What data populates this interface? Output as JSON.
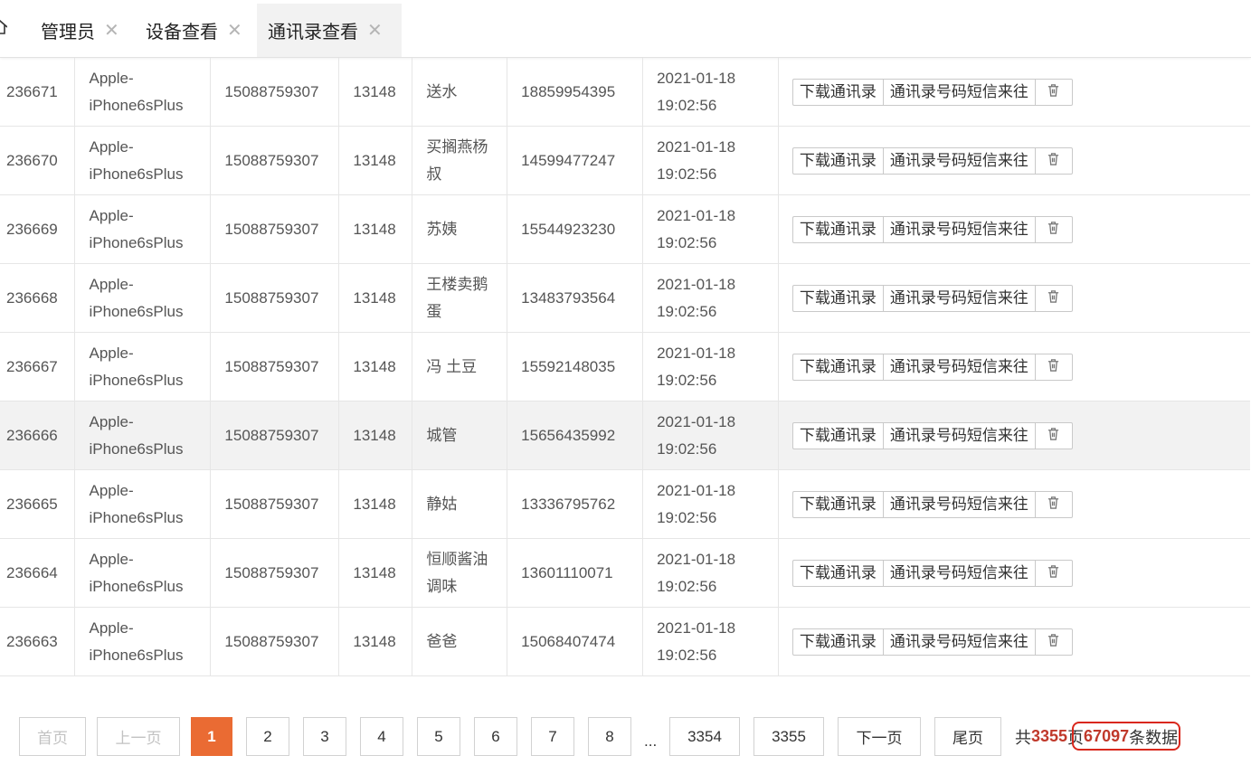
{
  "tabs": [
    {
      "label": "管理员"
    },
    {
      "label": "设备查看"
    },
    {
      "label": "通讯录查看"
    }
  ],
  "icons": {
    "home": "home-icon",
    "close": "close-icon",
    "delete": "trash-icon"
  },
  "colors": {
    "accent": "#ea6b33",
    "highlight": "#d9271c",
    "count": "#c0392b"
  },
  "table": {
    "rows": [
      {
        "id": "236671",
        "device": "Apple-iPhone6sPlus",
        "phone": "15088759307",
        "uid": "13148",
        "name": "送水",
        "number": "18859954395",
        "date": "2021-01-18",
        "time": "19:02:56"
      },
      {
        "id": "236670",
        "device": "Apple-iPhone6sPlus",
        "phone": "15088759307",
        "uid": "13148",
        "name": "买搁燕杨叔",
        "number": "14599477247",
        "date": "2021-01-18",
        "time": "19:02:56"
      },
      {
        "id": "236669",
        "device": "Apple-iPhone6sPlus",
        "phone": "15088759307",
        "uid": "13148",
        "name": "苏姨",
        "number": "15544923230",
        "date": "2021-01-18",
        "time": "19:02:56"
      },
      {
        "id": "236668",
        "device": "Apple-iPhone6sPlus",
        "phone": "15088759307",
        "uid": "13148",
        "name": "王楼卖鹅蛋",
        "number": "13483793564",
        "date": "2021-01-18",
        "time": "19:02:56"
      },
      {
        "id": "236667",
        "device": "Apple-iPhone6sPlus",
        "phone": "15088759307",
        "uid": "13148",
        "name": "冯 土豆",
        "number": "15592148035",
        "date": "2021-01-18",
        "time": "19:02:56"
      },
      {
        "id": "236666",
        "device": "Apple-iPhone6sPlus",
        "phone": "15088759307",
        "uid": "13148",
        "name": "城管",
        "number": "15656435992",
        "date": "2021-01-18",
        "time": "19:02:56"
      },
      {
        "id": "236665",
        "device": "Apple-iPhone6sPlus",
        "phone": "15088759307",
        "uid": "13148",
        "name": "静姑",
        "number": "13336795762",
        "date": "2021-01-18",
        "time": "19:02:56"
      },
      {
        "id": "236664",
        "device": "Apple-iPhone6sPlus",
        "phone": "15088759307",
        "uid": "13148",
        "name": "恒顺酱油调味",
        "number": "13601110071",
        "date": "2021-01-18",
        "time": "19:02:56"
      },
      {
        "id": "236663",
        "device": "Apple-iPhone6sPlus",
        "phone": "15088759307",
        "uid": "13148",
        "name": "爸爸",
        "number": "15068407474",
        "date": "2021-01-18",
        "time": "19:02:56"
      }
    ],
    "actions": {
      "download": "下载通讯录",
      "sms": "通讯录号码短信来往"
    },
    "hover_row": 5
  },
  "pager": {
    "first": "首页",
    "prev": "上一页",
    "pages": [
      "1",
      "2",
      "3",
      "4",
      "5",
      "6",
      "7",
      "8"
    ],
    "ellipsis": "...",
    "tail_pages": [
      "3354",
      "3355"
    ],
    "next": "下一页",
    "last": "尾页",
    "current": "1",
    "summary_prefix": "共",
    "total_pages": "3355",
    "summary_mid": "页",
    "total_records": "67097",
    "summary_suffix": "条数据"
  }
}
